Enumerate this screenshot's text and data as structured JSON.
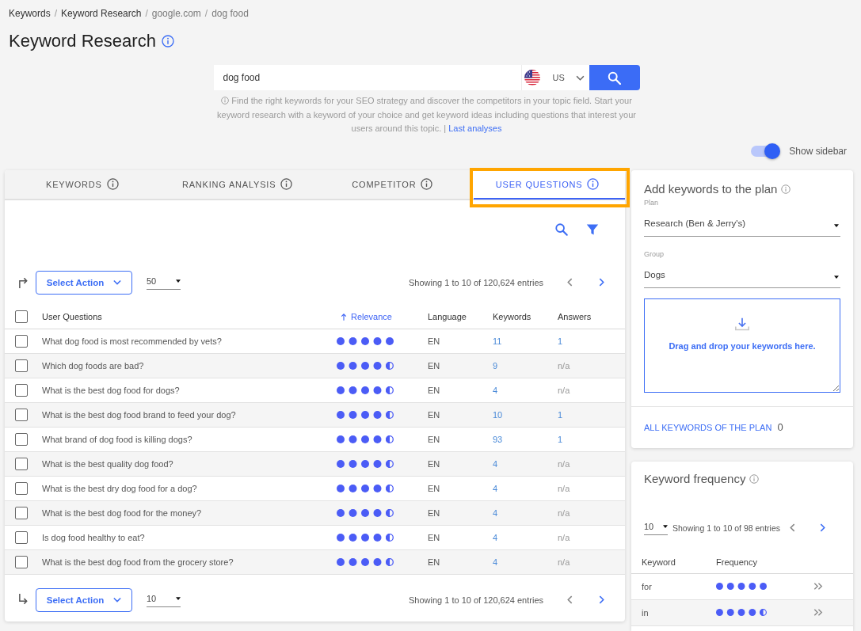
{
  "breadcrumb": [
    {
      "label": "Keywords",
      "link": true
    },
    {
      "separator": "/",
      "label": "Keyword Research",
      "link": true
    },
    {
      "separator": "/",
      "label": "google.com",
      "link": false
    },
    {
      "separator": "/",
      "label": "dog food",
      "link": false
    }
  ],
  "title": "Keyword Research",
  "search": {
    "value": "dog food",
    "country": "US"
  },
  "help_text": {
    "text": "Find the right keywords for your SEO strategy and discover the competitors in your topic field. Start your keyword research with a keyword of your choice and get keyword ideas including questions that interest your users around this topic. |",
    "link": "Last analyses"
  },
  "sidebar_toggle": {
    "label": "Show sidebar",
    "on": true
  },
  "tabs": [
    {
      "label": "KEYWORDS",
      "selected": false,
      "highlighted": false
    },
    {
      "label": "RANKING ANALYSIS",
      "selected": false,
      "highlighted": false
    },
    {
      "label": "COMPETITOR",
      "selected": false,
      "highlighted": false
    },
    {
      "label": "USER QUESTIONS",
      "selected": true,
      "highlighted": true
    }
  ],
  "top_pager": {
    "action_button": "Select Action",
    "per_page": "50",
    "summary": "Showing 1 to 10 of 120,624 entries"
  },
  "table": {
    "header_checked": false,
    "columns": [
      {
        "label": "User Questions",
        "sorted": false
      },
      {
        "label": "Relevance",
        "sorted": true
      },
      {
        "label": "Language",
        "sorted": false
      },
      {
        "label": "Keywords",
        "sorted": false
      },
      {
        "label": "Answers",
        "sorted": false
      }
    ],
    "rows": [
      {
        "checked": false,
        "question": "What dog food is most recommended by vets?",
        "stars": 5,
        "language": "EN",
        "keywords": "11",
        "answers": {
          "text": "1",
          "link": true
        }
      },
      {
        "checked": false,
        "question": "Which dog foods are bad?",
        "stars": 4.5,
        "language": "EN",
        "keywords": "9",
        "answers": {
          "text": "n/a",
          "link": false
        }
      },
      {
        "checked": false,
        "question": "What is the best dog food for dogs?",
        "stars": 4.5,
        "language": "EN",
        "keywords": "4",
        "answers": {
          "text": "n/a",
          "link": false
        }
      },
      {
        "checked": false,
        "question": "What is the best dog food brand to feed your dog?",
        "stars": 4.5,
        "language": "EN",
        "keywords": "10",
        "answers": {
          "text": "1",
          "link": true
        }
      },
      {
        "checked": false,
        "question": "What brand of dog food is killing dogs?",
        "stars": 4.5,
        "language": "EN",
        "keywords": "93",
        "answers": {
          "text": "1",
          "link": true
        }
      },
      {
        "checked": false,
        "question": "What is the best quality dog food?",
        "stars": 4.5,
        "language": "EN",
        "keywords": "4",
        "answers": {
          "text": "n/a",
          "link": false
        }
      },
      {
        "checked": false,
        "question": "What is the best dry dog food for a dog?",
        "stars": 4.5,
        "language": "EN",
        "keywords": "4",
        "answers": {
          "text": "n/a",
          "link": false
        }
      },
      {
        "checked": false,
        "question": "What is the best dog food for the money?",
        "stars": 4.5,
        "language": "EN",
        "keywords": "4",
        "answers": {
          "text": "n/a",
          "link": false
        }
      },
      {
        "checked": false,
        "question": "Is dog food healthy to eat?",
        "stars": 4.5,
        "language": "EN",
        "keywords": "4",
        "answers": {
          "text": "n/a",
          "link": false
        }
      },
      {
        "checked": false,
        "question": "What is the best dog food from the grocery store?",
        "stars": 4.5,
        "language": "EN",
        "keywords": "4",
        "answers": {
          "text": "n/a",
          "link": false
        }
      }
    ]
  },
  "bottom_pager": {
    "action_button": "Select Action",
    "per_page": "10",
    "summary": "Showing 1 to 10 of 120,624 entries"
  },
  "plan_panel": {
    "title": "Add keywords to the plan",
    "plan_label": "Plan",
    "plan_value": "Research (Ben & Jerry's)",
    "group_label": "Group",
    "group_value": "Dogs",
    "drop_field": {
      "placeholder": "Drag and drop your keywords here."
    },
    "all_keywords_link": "ALL KEYWORDS OF THE PLAN",
    "all_keywords_count": "0"
  },
  "frequency_panel": {
    "title": "Keyword frequency",
    "per_page": "10",
    "summary": "Showing 1 to 10 of 98 entries",
    "columns": [
      "Keyword",
      "Frequency"
    ],
    "rows": [
      {
        "keyword": "for",
        "stars": 5
      },
      {
        "keyword": "in",
        "stars": 4.5
      }
    ]
  }
}
